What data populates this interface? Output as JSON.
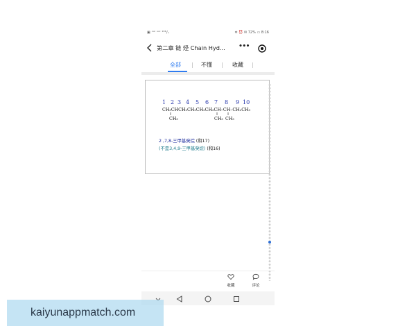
{
  "status_bar": {
    "left": "▣ ᵒᵘˡ ᵒᵘˡ ¹⁹ᴷ/ₛ",
    "right": "✲ ⏰ ✉ 72% ▭ 8:16"
  },
  "nav": {
    "title": "第二章 链 烃 Chain Hyd...",
    "more": "•••"
  },
  "tabs": [
    {
      "label": "全部",
      "active": true
    },
    {
      "label": "不懂",
      "active": false
    },
    {
      "label": "收藏",
      "active": false
    }
  ],
  "formula": {
    "numbers": [
      "1",
      "2",
      "3",
      "4",
      "5",
      "6",
      "7",
      "8",
      "9",
      "10"
    ],
    "main_chain": "CH₃CHCH₂CH₂CH₂CH₂CH–CH–CH₂CH₃",
    "branch_left": "CH₃",
    "branch_mid": "CH₃",
    "branch_right": "CH₃"
  },
  "answer": {
    "line1": "2 ,7,8-三甲基癸烷",
    "line1_score": "(和17)",
    "line2_open": "(",
    "line2": "不是3,4,9-三甲基癸烷",
    "line2_close": ")",
    "line2_score": "(和16)"
  },
  "actions": {
    "favorite": "收藏",
    "comment": "评论"
  },
  "watermark": "kaiyunappmatch.com",
  "colors": {
    "accent": "#2f7cf0",
    "formula_numbers": "#2233aa",
    "answer_primary": "#1a2a9c",
    "answer_secondary": "#1a7a8a"
  }
}
